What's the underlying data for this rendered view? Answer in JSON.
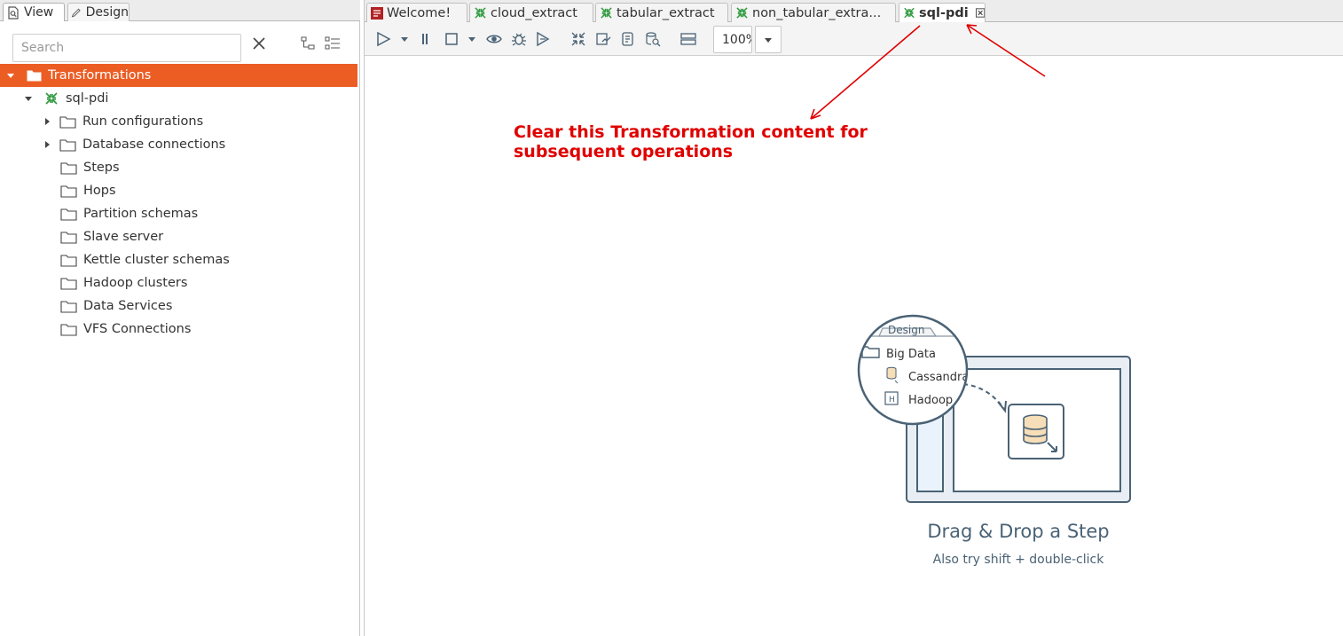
{
  "left_panel": {
    "tabs": [
      {
        "label": "View"
      },
      {
        "label": "Design"
      }
    ],
    "search": {
      "placeholder": "Search",
      "value": ""
    },
    "tree": [
      {
        "label": "Transformations"
      },
      {
        "label": "sql-pdi"
      },
      {
        "label": "Run configurations"
      },
      {
        "label": "Database connections"
      },
      {
        "label": "Steps"
      },
      {
        "label": "Hops"
      },
      {
        "label": "Partition schemas"
      },
      {
        "label": "Slave server"
      },
      {
        "label": "Kettle cluster schemas"
      },
      {
        "label": "Hadoop clusters"
      },
      {
        "label": "Data Services"
      },
      {
        "label": "VFS Connections"
      }
    ]
  },
  "doc_tabs": [
    {
      "label": "Welcome!"
    },
    {
      "label": "cloud_extract"
    },
    {
      "label": "tabular_extract"
    },
    {
      "label": "non_tabular_extra..."
    },
    {
      "label": "sql-pdi"
    }
  ],
  "toolbar": {
    "zoom": "100%"
  },
  "canvas": {
    "annotation_line1": "Clear this Transformation content for",
    "annotation_line2": "subsequent operations",
    "illustration": {
      "tab_label": "Design",
      "folder_label": "Big Data",
      "item1": "Cassandra",
      "item2": "Hadoop"
    },
    "drag_drop_title": "Drag & Drop a Step",
    "drag_drop_subtitle": "Also try shift + double-click"
  },
  "colors": {
    "selected_row": "#ec5d24",
    "annotation": "#e00000",
    "illustration_stroke": "#4a6275",
    "transform_icon": "#2e9a3e"
  }
}
